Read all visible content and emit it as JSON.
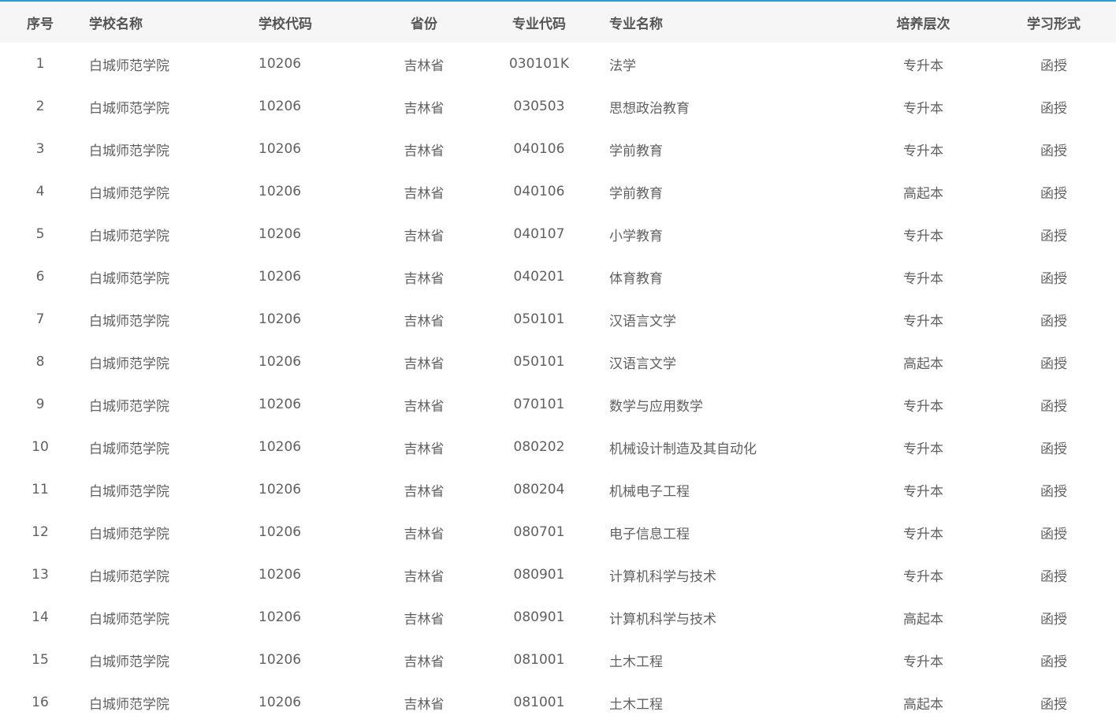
{
  "columns": {
    "index": "序号",
    "school_name": "学校名称",
    "school_code": "学校代码",
    "province": "省份",
    "major_code": "专业代码",
    "major_name": "专业名称",
    "level": "培养层次",
    "study_form": "学习形式"
  },
  "rows": [
    {
      "index": "1",
      "school_name": "白城师范学院",
      "school_code": "10206",
      "province": "吉林省",
      "major_code": "030101K",
      "major_name": "法学",
      "level": "专升本",
      "study_form": "函授"
    },
    {
      "index": "2",
      "school_name": "白城师范学院",
      "school_code": "10206",
      "province": "吉林省",
      "major_code": "030503",
      "major_name": "思想政治教育",
      "level": "专升本",
      "study_form": "函授"
    },
    {
      "index": "3",
      "school_name": "白城师范学院",
      "school_code": "10206",
      "province": "吉林省",
      "major_code": "040106",
      "major_name": "学前教育",
      "level": "专升本",
      "study_form": "函授"
    },
    {
      "index": "4",
      "school_name": "白城师范学院",
      "school_code": "10206",
      "province": "吉林省",
      "major_code": "040106",
      "major_name": "学前教育",
      "level": "高起本",
      "study_form": "函授"
    },
    {
      "index": "5",
      "school_name": "白城师范学院",
      "school_code": "10206",
      "province": "吉林省",
      "major_code": "040107",
      "major_name": "小学教育",
      "level": "专升本",
      "study_form": "函授"
    },
    {
      "index": "6",
      "school_name": "白城师范学院",
      "school_code": "10206",
      "province": "吉林省",
      "major_code": "040201",
      "major_name": "体育教育",
      "level": "专升本",
      "study_form": "函授"
    },
    {
      "index": "7",
      "school_name": "白城师范学院",
      "school_code": "10206",
      "province": "吉林省",
      "major_code": "050101",
      "major_name": "汉语言文学",
      "level": "专升本",
      "study_form": "函授"
    },
    {
      "index": "8",
      "school_name": "白城师范学院",
      "school_code": "10206",
      "province": "吉林省",
      "major_code": "050101",
      "major_name": "汉语言文学",
      "level": "高起本",
      "study_form": "函授"
    },
    {
      "index": "9",
      "school_name": "白城师范学院",
      "school_code": "10206",
      "province": "吉林省",
      "major_code": "070101",
      "major_name": "数学与应用数学",
      "level": "专升本",
      "study_form": "函授"
    },
    {
      "index": "10",
      "school_name": "白城师范学院",
      "school_code": "10206",
      "province": "吉林省",
      "major_code": "080202",
      "major_name": "机械设计制造及其自动化",
      "level": "专升本",
      "study_form": "函授"
    },
    {
      "index": "11",
      "school_name": "白城师范学院",
      "school_code": "10206",
      "province": "吉林省",
      "major_code": "080204",
      "major_name": "机械电子工程",
      "level": "专升本",
      "study_form": "函授"
    },
    {
      "index": "12",
      "school_name": "白城师范学院",
      "school_code": "10206",
      "province": "吉林省",
      "major_code": "080701",
      "major_name": "电子信息工程",
      "level": "专升本",
      "study_form": "函授"
    },
    {
      "index": "13",
      "school_name": "白城师范学院",
      "school_code": "10206",
      "province": "吉林省",
      "major_code": "080901",
      "major_name": "计算机科学与技术",
      "level": "专升本",
      "study_form": "函授"
    },
    {
      "index": "14",
      "school_name": "白城师范学院",
      "school_code": "10206",
      "province": "吉林省",
      "major_code": "080901",
      "major_name": "计算机科学与技术",
      "level": "高起本",
      "study_form": "函授"
    },
    {
      "index": "15",
      "school_name": "白城师范学院",
      "school_code": "10206",
      "province": "吉林省",
      "major_code": "081001",
      "major_name": "土木工程",
      "level": "专升本",
      "study_form": "函授"
    },
    {
      "index": "16",
      "school_name": "白城师范学院",
      "school_code": "10206",
      "province": "吉林省",
      "major_code": "081001",
      "major_name": "土木工程",
      "level": "高起本",
      "study_form": "函授"
    }
  ]
}
